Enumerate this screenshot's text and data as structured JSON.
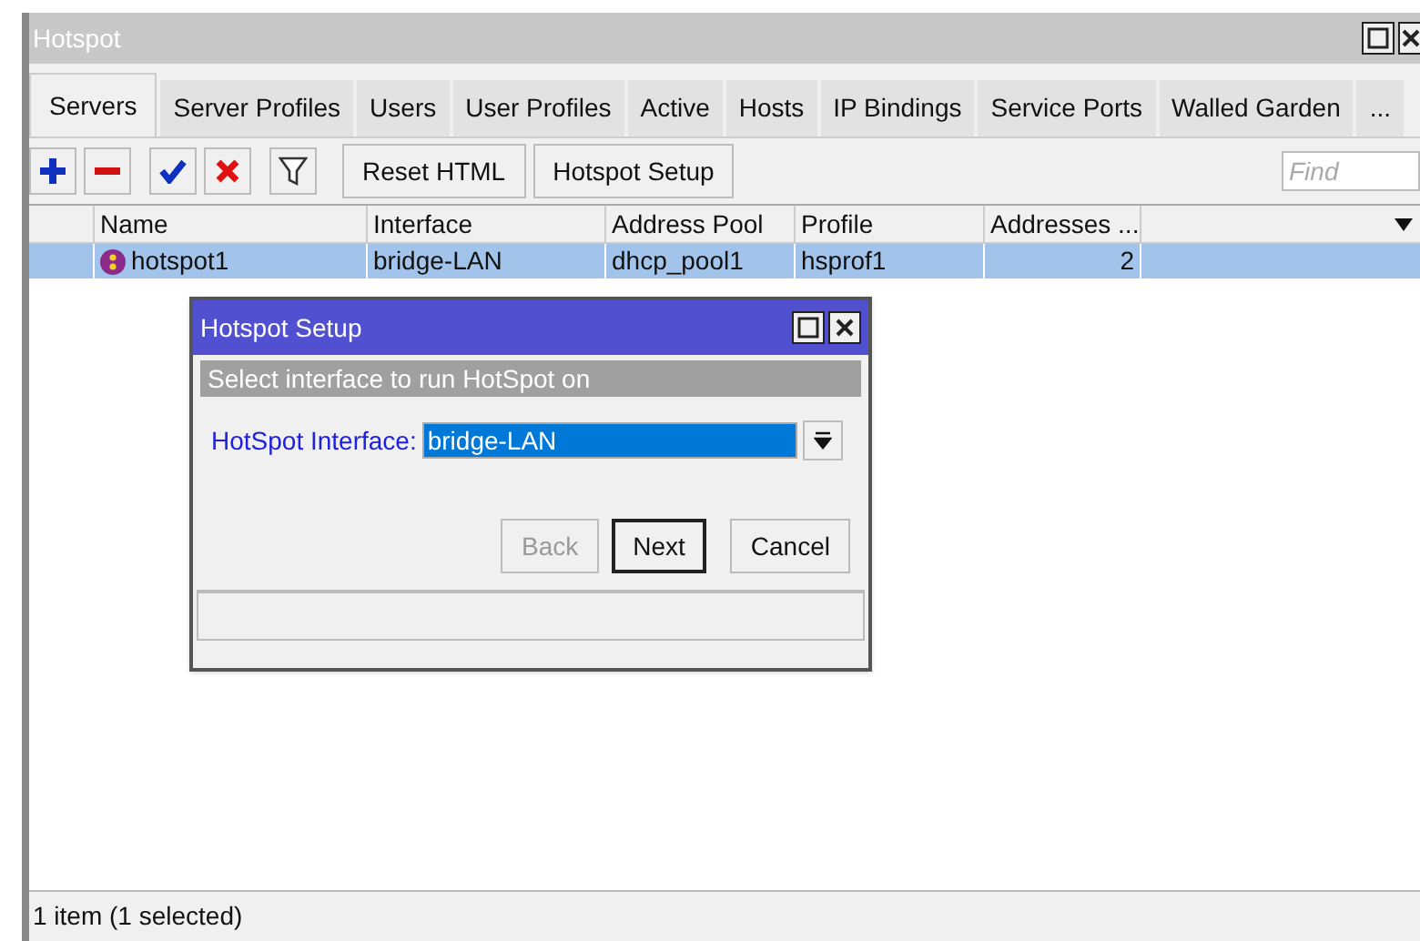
{
  "window": {
    "title": "Hotspot"
  },
  "tabs": [
    {
      "label": "Servers",
      "selected": true
    },
    {
      "label": "Server Profiles",
      "selected": false
    },
    {
      "label": "Users",
      "selected": false
    },
    {
      "label": "User Profiles",
      "selected": false
    },
    {
      "label": "Active",
      "selected": false
    },
    {
      "label": "Hosts",
      "selected": false
    },
    {
      "label": "IP Bindings",
      "selected": false
    },
    {
      "label": "Service Ports",
      "selected": false
    },
    {
      "label": "Walled Garden",
      "selected": false
    },
    {
      "label": "...",
      "selected": false
    }
  ],
  "toolbar": {
    "buttons": [
      "Reset HTML",
      "Hotspot Setup"
    ],
    "search": {
      "placeholder": "Find"
    }
  },
  "table": {
    "columns": [
      "Name",
      "Interface",
      "Address Pool",
      "Profile",
      "Addresses ..."
    ],
    "rows": [
      {
        "selected": true,
        "cells": [
          "hotspot1",
          "bridge-LAN",
          "dhcp_pool1",
          "hsprof1",
          "2"
        ]
      }
    ]
  },
  "dialog": {
    "title": "Hotspot Setup",
    "subtitle": "Select interface to run HotSpot on",
    "field_label": "HotSpot Interface:",
    "field_value": "bridge-LAN",
    "buttons": [
      {
        "label": "Back",
        "disabled": true,
        "default": false
      },
      {
        "label": "Next",
        "disabled": false,
        "default": true
      },
      {
        "label": "Cancel",
        "disabled": false,
        "default": false
      }
    ]
  },
  "status_bar": "1 item (1 selected)"
}
